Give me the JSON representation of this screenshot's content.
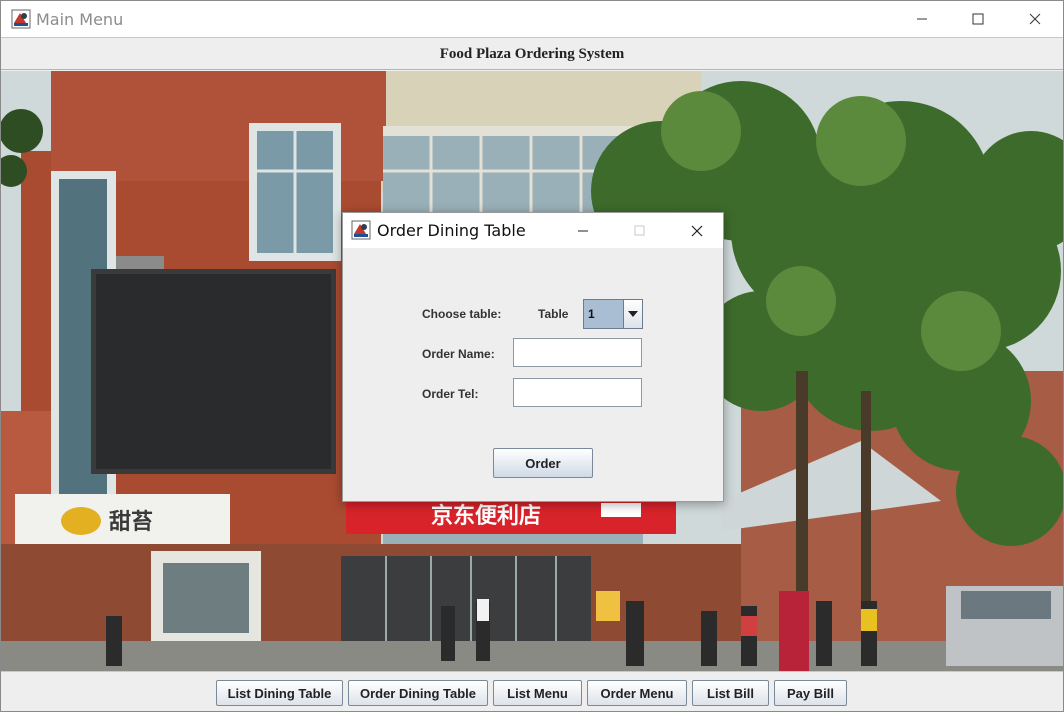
{
  "window": {
    "title": "Main Menu",
    "icon": "java-app-icon"
  },
  "header": {
    "title": "Food Plaza Ordering System"
  },
  "background": {
    "description_icon": "building-photo",
    "shop_sign_text": "甜苔",
    "store_sign_text": "京东便利店",
    "colors": {
      "sky": "#dde3e3",
      "brick": "#a04a30",
      "trees": "#3e6b2c",
      "red_banner": "#d8232a"
    }
  },
  "dialog": {
    "title": "Order Dining Table",
    "choose_table_label": "Choose table:",
    "table_label": "Table",
    "table_selected": "1",
    "order_name_label": "Order Name:",
    "order_name_value": "",
    "order_tel_label": "Order Tel:",
    "order_tel_value": "",
    "order_button": "Order"
  },
  "footer": {
    "buttons": [
      {
        "label": "List Dining Table"
      },
      {
        "label": "Order Dining Table"
      },
      {
        "label": "List Menu"
      },
      {
        "label": "Order Menu"
      },
      {
        "label": "List Bill"
      },
      {
        "label": "Pay Bill"
      }
    ]
  }
}
